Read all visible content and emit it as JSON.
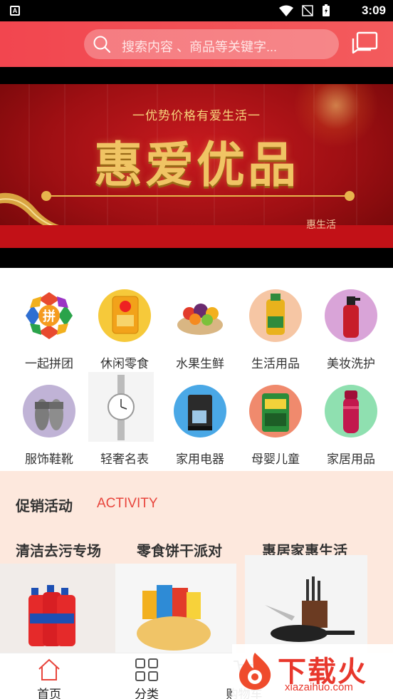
{
  "status_bar": {
    "time": "3:09"
  },
  "header": {
    "search_placeholder": "搜索内容 、商品等关键字...",
    "icons": {
      "search": "search-icon",
      "message": "message-icon"
    },
    "accent_color": "#f2464f"
  },
  "banner": {
    "subtitle": "一优势价格有爱生活一",
    "title": "惠爱优品",
    "corner_text": "惠生活"
  },
  "categories": [
    {
      "label": "一起拼团",
      "icon": "group-buy-icon"
    },
    {
      "label": "休闲零食",
      "icon": "snacks-icon"
    },
    {
      "label": "水果生鲜",
      "icon": "fruit-icon"
    },
    {
      "label": "生活用品",
      "icon": "oil-icon"
    },
    {
      "label": "美妆洗护",
      "icon": "shampoo-icon"
    },
    {
      "label": "服饰鞋靴",
      "icon": "slippers-icon"
    },
    {
      "label": "轻奢名表",
      "icon": "watch-icon"
    },
    {
      "label": "家用电器",
      "icon": "coffee-maker-icon"
    },
    {
      "label": "母婴儿童",
      "icon": "seaweed-icon"
    },
    {
      "label": "家居用品",
      "icon": "thermos-icon"
    }
  ],
  "group_buy_glyph": "拼",
  "promo": {
    "title": "促销活动",
    "title_en": "ACTIVITY",
    "cards": [
      {
        "title": "清洁去污专场"
      },
      {
        "title": "零食饼干派对"
      },
      {
        "title": "惠居家惠生活"
      }
    ],
    "background_color": "#fde8dd"
  },
  "tabbar": {
    "items": [
      {
        "label": "首页",
        "icon": "home-icon"
      },
      {
        "label": "分类",
        "icon": "grid-icon"
      },
      {
        "label": "购物车",
        "icon": "cart-icon"
      }
    ]
  },
  "watermark": {
    "text": "下载火",
    "url": "xiazaihuo.com"
  }
}
